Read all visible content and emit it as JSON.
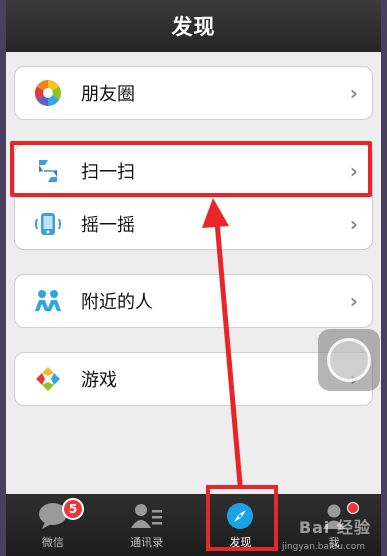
{
  "header": {
    "title": "发现"
  },
  "groups": [
    {
      "items": [
        {
          "label": "朋友圈",
          "icon": "moments-icon"
        }
      ]
    },
    {
      "items": [
        {
          "label": "扫一扫",
          "icon": "scan-icon"
        },
        {
          "label": "摇一摇",
          "icon": "shake-icon"
        }
      ]
    },
    {
      "items": [
        {
          "label": "附近的人",
          "icon": "people-nearby-icon"
        }
      ]
    },
    {
      "items": [
        {
          "label": "游戏",
          "icon": "games-icon"
        }
      ]
    }
  ],
  "chevron": "›",
  "tabbar": {
    "tabs": [
      {
        "label": "微信",
        "badge": "5",
        "icon": "chat-bubble-icon"
      },
      {
        "label": "通讯录",
        "icon": "contacts-icon"
      },
      {
        "label": "发现",
        "icon": "compass-icon",
        "active": true
      },
      {
        "label": "我",
        "icon": "person-icon",
        "dot": true
      }
    ]
  },
  "watermark": {
    "main": "Bai 经验",
    "sub": "jingyan.baidu.com"
  },
  "colors": {
    "highlight": "#e8262a",
    "badge": "#e8383a",
    "accent": "#1aa1e6"
  }
}
